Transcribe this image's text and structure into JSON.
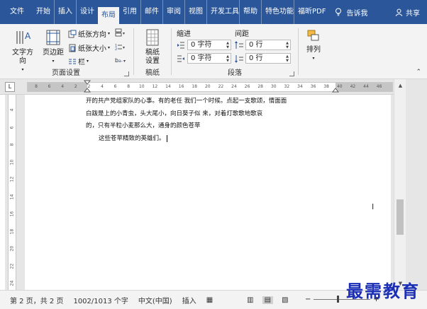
{
  "tabs": [
    {
      "label": "文件"
    },
    {
      "label": "开始"
    },
    {
      "label": "插入"
    },
    {
      "label": "设计"
    },
    {
      "label": "布局"
    },
    {
      "label": "引用"
    },
    {
      "label": "邮件"
    },
    {
      "label": "审阅"
    },
    {
      "label": "视图"
    },
    {
      "label": "开发工具"
    },
    {
      "label": "帮助"
    },
    {
      "label": "特色功能"
    },
    {
      "label": "福昕PDF"
    }
  ],
  "tell_me": "告诉我",
  "share": "共享",
  "ribbon": {
    "page_setup": {
      "group_label": "页面设置",
      "text_direction": "文字方向",
      "margins": "页边距",
      "orientation": "纸张方向",
      "size": "纸张大小",
      "columns": "栏"
    },
    "manuscript": {
      "group_label": "稿纸",
      "btn": "稿纸设置",
      "btn_line1": "稿纸",
      "btn_line2": "设置"
    },
    "paragraph": {
      "group_label": "段落",
      "indent_label": "缩进",
      "spacing_label": "间距",
      "indent_left": "0 字符",
      "indent_right": "0 字符",
      "spacing_before": "0 行",
      "spacing_after": "0 行"
    },
    "arrange": {
      "btn": "排列"
    }
  },
  "ruler": {
    "corner": "L",
    "ticks": [
      "8",
      "6",
      "4",
      "2",
      "2",
      "4",
      "6",
      "8",
      "10",
      "12",
      "14",
      "16",
      "18",
      "20",
      "22",
      "24",
      "26",
      "28",
      "30",
      "32",
      "34",
      "36",
      "38",
      "40",
      "42",
      "44",
      "46"
    ],
    "vticks": [
      "4",
      "6",
      "8",
      "10",
      "12",
      "14",
      "16",
      "18",
      "20",
      "22",
      "24"
    ]
  },
  "document": {
    "lines": [
      "开的共产党组家队的心事。有的老任           我们一个时候。点起一支歌颂，情面面",
      "白跋是上的小青虫，头大尾小，向日葵子似      来，对着灯歌歌地歌哀",
      "的，只有半粒小麦那么大，通身的颜色苍苹",
      "这些苍苹精致的英雄们。"
    ]
  },
  "status": {
    "page": "第 2 页，共 2 页",
    "words": "1002/1013 个字",
    "language": "中文(中国)",
    "mode": "插入",
    "zoom_level": 0.42
  },
  "watermark": "最需教育"
}
